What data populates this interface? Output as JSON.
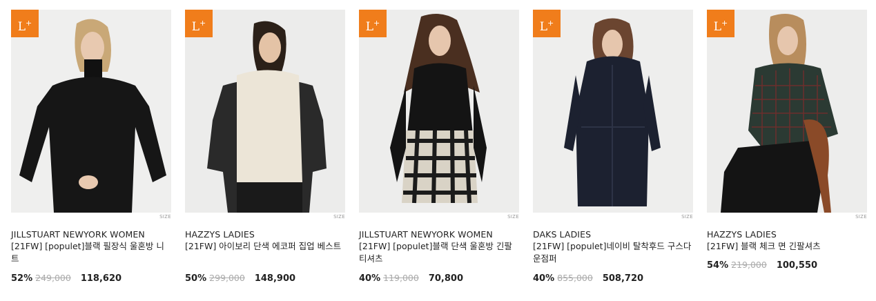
{
  "badge": {
    "text": "L",
    "sup": "+"
  },
  "size_label": "SIZE",
  "colors": {
    "badge": "#f07d1b",
    "strike": "#aaaaaa"
  },
  "products": [
    {
      "brand": "JILLSTUART NEWYORK WOMEN",
      "name": "[21FW] [populet]블랙 필장식 울혼방 니트",
      "discount": "52%",
      "original_price": "249,000",
      "sale_price": "118,620"
    },
    {
      "brand": "HAZZYS LADIES",
      "name": "[21FW] 아이보리 단색 에코퍼 집업 베스트",
      "discount": "50%",
      "original_price": "299,000",
      "sale_price": "148,900"
    },
    {
      "brand": "JILLSTUART NEWYORK WOMEN",
      "name": "[21FW] [populet]블랙 단색 울혼방 긴팔티셔츠",
      "discount": "40%",
      "original_price": "119,000",
      "sale_price": "70,800"
    },
    {
      "brand": "DAKS LADIES",
      "name": "[21FW] [populet]네이비 탈착후드 구스다운점퍼",
      "discount": "40%",
      "original_price": "855,000",
      "sale_price": "508,720"
    },
    {
      "brand": "HAZZYS LADIES",
      "name": "[21FW] 블랙 체크 면 긴팔셔츠",
      "discount": "54%",
      "original_price": "219,000",
      "sale_price": "100,550"
    }
  ]
}
